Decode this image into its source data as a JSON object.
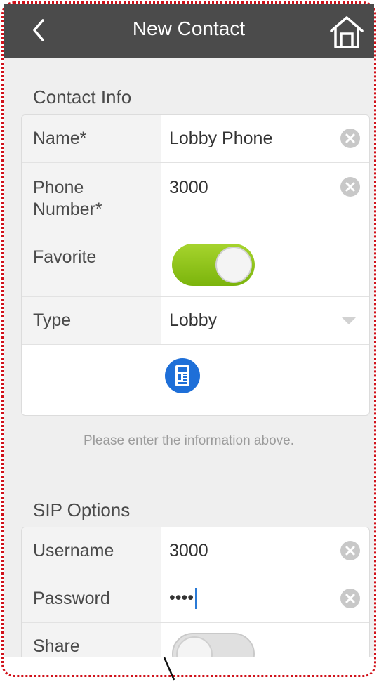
{
  "header": {
    "title": "New Contact"
  },
  "contact_info": {
    "section_title": "Contact Info",
    "name": {
      "label": "Name*",
      "value": "Lobby Phone"
    },
    "phone": {
      "label_line1": "Phone",
      "label_line2": "Number*",
      "value": "3000"
    },
    "favorite": {
      "label": "Favorite",
      "state": "on"
    },
    "type": {
      "label": "Type",
      "value": "Lobby"
    },
    "icon": "lobby-station-icon"
  },
  "hint": "Please enter the information above.",
  "sip_options": {
    "section_title": "SIP Options",
    "username": {
      "label": "Username",
      "value": "3000"
    },
    "password": {
      "label": "Password",
      "value": "••••"
    },
    "share": {
      "label": "Share",
      "state": "off"
    }
  },
  "colors": {
    "topbar": "#4b4b4b",
    "toggle_on": "#8ec21a",
    "icon_blue": "#1e6fd8",
    "frame": "#d0121b"
  }
}
